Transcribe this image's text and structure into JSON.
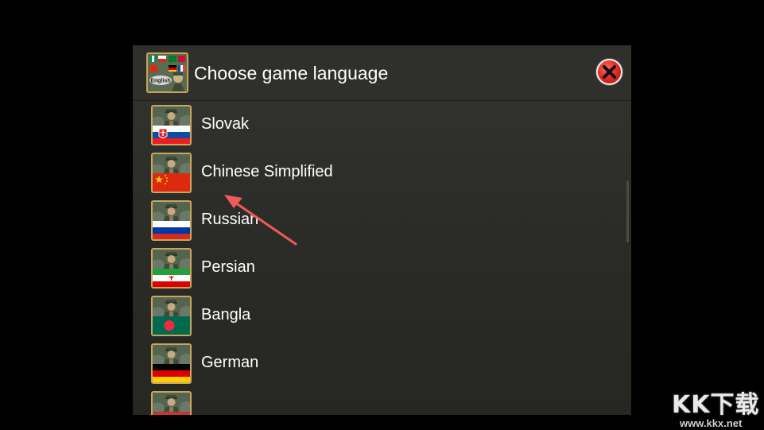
{
  "dialog": {
    "title": "Choose game language",
    "header_icon_text": "English",
    "close_icon": "close-icon"
  },
  "languages": [
    {
      "label": "",
      "flag": "partial"
    },
    {
      "label": "Slovak",
      "flag": "slovakia"
    },
    {
      "label": "Chinese Simplified",
      "flag": "china"
    },
    {
      "label": "Russian",
      "flag": "russia"
    },
    {
      "label": "Persian",
      "flag": "iran"
    },
    {
      "label": "Bangla",
      "flag": "bangladesh"
    },
    {
      "label": "German",
      "flag": "germany"
    },
    {
      "label": "",
      "flag": "partial"
    }
  ],
  "annotation": {
    "arrow_color": "#f05a5a"
  },
  "watermark": {
    "logo": "KK下载",
    "url": "www.kkx.net"
  },
  "colors": {
    "accent_border": "#c9a65b",
    "close_red": "#e02a1e",
    "panel_bg": "#2b2c28"
  }
}
